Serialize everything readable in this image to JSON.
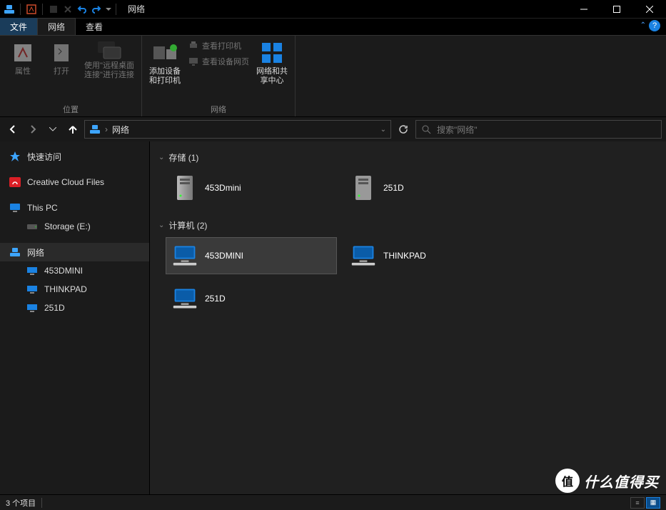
{
  "titlebar": {
    "title": "网络"
  },
  "tabs": {
    "file": "文件",
    "network": "网络",
    "view": "查看"
  },
  "ribbon": {
    "group_location": "位置",
    "group_network": "网络",
    "properties": "属性",
    "open": "打开",
    "remote_desktop": "使用\"远程桌面连接\"进行连接",
    "add_devices": "添加设备和打印机",
    "view_printers": "查看打印机",
    "view_device_page": "查看设备网页",
    "network_center": "网络和共享中心"
  },
  "breadcrumb": {
    "location": "网络"
  },
  "search": {
    "placeholder": "搜索\"网络\""
  },
  "sidebar": {
    "quick_access": "快速访问",
    "creative_cloud": "Creative Cloud Files",
    "this_pc": "This PC",
    "storage_e": "Storage (E:)",
    "network": "网络",
    "children": {
      "c0": "453DMINI",
      "c1": "THINKPAD",
      "c2": "251D"
    }
  },
  "content": {
    "storage_header": "存储 (1)",
    "computers_header": "计算机 (2)",
    "storage": {
      "s0": "453Dmini",
      "s1": "251D"
    },
    "computers": {
      "c0": "453DMINI",
      "c1": "THINKPAD",
      "c2": "251D"
    }
  },
  "status": {
    "items": "3 个项目"
  },
  "watermark": {
    "badge": "值",
    "text": "什么值得买"
  }
}
